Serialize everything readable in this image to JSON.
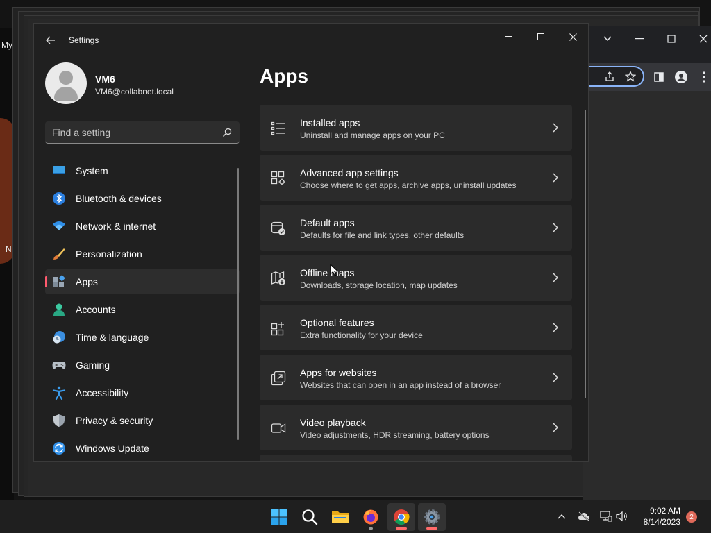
{
  "desktop": {
    "icon_labels": [
      "My",
      "N"
    ]
  },
  "settings": {
    "window_title": "Settings",
    "profile": {
      "name": "VM6",
      "email": "VM6@collabnet.local"
    },
    "search": {
      "placeholder": "Find a setting"
    },
    "nav": [
      {
        "label": "System",
        "icon": "system-icon"
      },
      {
        "label": "Bluetooth & devices",
        "icon": "bluetooth-icon"
      },
      {
        "label": "Network & internet",
        "icon": "wifi-icon"
      },
      {
        "label": "Personalization",
        "icon": "brush-icon"
      },
      {
        "label": "Apps",
        "icon": "apps-icon",
        "active": true
      },
      {
        "label": "Accounts",
        "icon": "accounts-icon"
      },
      {
        "label": "Time & language",
        "icon": "clock-globe-icon"
      },
      {
        "label": "Gaming",
        "icon": "gamepad-icon"
      },
      {
        "label": "Accessibility",
        "icon": "accessibility-icon"
      },
      {
        "label": "Privacy & security",
        "icon": "shield-icon"
      },
      {
        "label": "Windows Update",
        "icon": "update-icon"
      }
    ],
    "page_title": "Apps",
    "cards": [
      {
        "title": "Installed apps",
        "subtitle": "Uninstall and manage apps on your PC",
        "icon": "installed-apps-icon"
      },
      {
        "title": "Advanced app settings",
        "subtitle": "Choose where to get apps, archive apps, uninstall updates",
        "icon": "advanced-app-settings-icon"
      },
      {
        "title": "Default apps",
        "subtitle": "Defaults for file and link types, other defaults",
        "icon": "default-apps-icon"
      },
      {
        "title": "Offline maps",
        "subtitle": "Downloads, storage location, map updates",
        "icon": "offline-maps-icon"
      },
      {
        "title": "Optional features",
        "subtitle": "Extra functionality for your device",
        "icon": "optional-features-icon"
      },
      {
        "title": "Apps for websites",
        "subtitle": "Websites that can open in an app instead of a browser",
        "icon": "apps-for-websites-icon"
      },
      {
        "title": "Video playback",
        "subtitle": "Video adjustments, HDR streaming, battery options",
        "icon": "video-playback-icon"
      }
    ]
  },
  "taskbar": {
    "apps": [
      "start-icon",
      "search-icon",
      "file-explorer-icon",
      "firefox-icon",
      "chrome-icon",
      "settings-icon"
    ],
    "time": "9:02 AM",
    "date": "8/14/2023",
    "notification_count": "2"
  },
  "colors": {
    "accent": "#ff5a6e",
    "window_bg": "#202020",
    "card_bg": "#2b2b2b",
    "taskbar_bg": "#1f1f1f"
  }
}
